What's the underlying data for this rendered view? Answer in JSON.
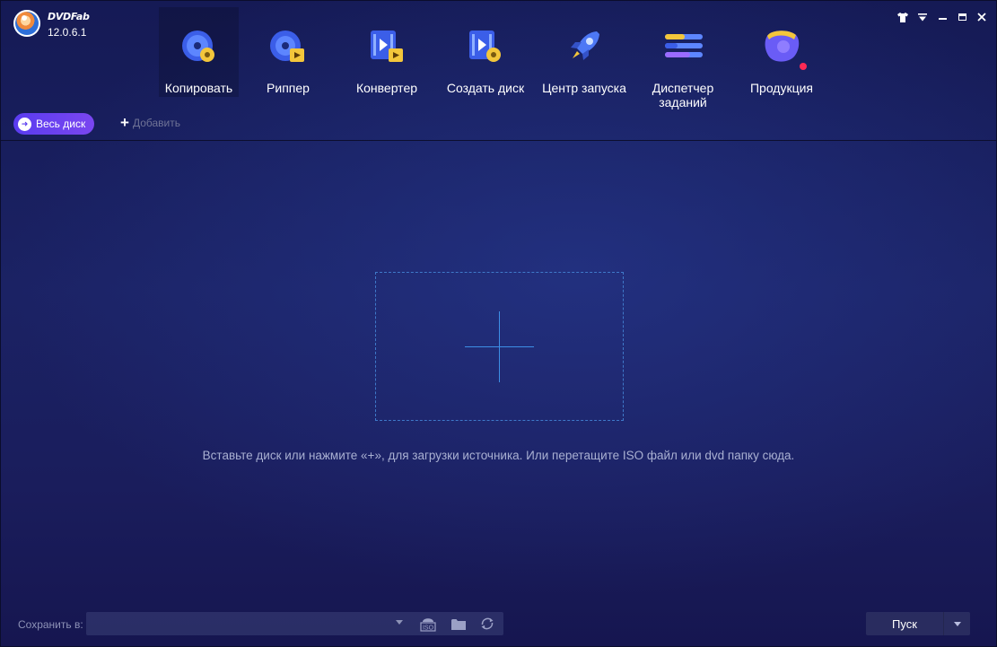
{
  "app": {
    "brand": "DVDFab",
    "version": "12.0.6.1"
  },
  "nav": {
    "items": [
      {
        "label": "Копировать",
        "icon": "copy-disc-icon"
      },
      {
        "label": "Риппер",
        "icon": "ripper-icon"
      },
      {
        "label": "Конвертер",
        "icon": "converter-icon"
      },
      {
        "label": "Создать диск",
        "icon": "create-disc-icon"
      },
      {
        "label": "Центр запуска",
        "icon": "rocket-icon"
      },
      {
        "label": "Диспетчер\nзаданий",
        "icon": "task-manager-icon"
      },
      {
        "label": "Продукция",
        "icon": "products-icon"
      }
    ],
    "active_index": 0
  },
  "subbar": {
    "mode_label": "Весь диск",
    "add_label": "Добавить"
  },
  "main": {
    "hint": "Вставьте диск или нажмите «+», для загрузки источника. Или перетащите ISO файл или dvd папку сюда."
  },
  "bottom": {
    "save_label": "Сохранить в:",
    "save_value": "",
    "iso_label": "ISO",
    "start_label": "Пуск"
  },
  "colors": {
    "accent": "#5a3cf0",
    "dropzone_border": "#3f79c9",
    "badge": "#ff2a55"
  }
}
